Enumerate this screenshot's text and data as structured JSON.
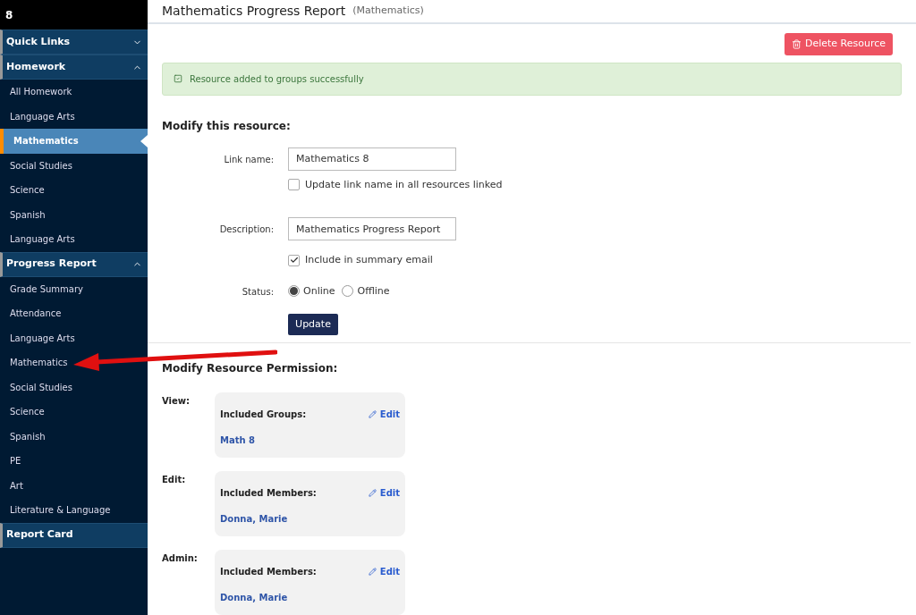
{
  "sidebar": {
    "header": "8",
    "sections": [
      {
        "title": "Quick Links",
        "expanded": false
      },
      {
        "title": "Homework",
        "expanded": true,
        "items": [
          {
            "label": "All Homework",
            "selected": false
          },
          {
            "label": "Language Arts",
            "selected": false
          },
          {
            "label": "Mathematics",
            "selected": true
          },
          {
            "label": "Social Studies",
            "selected": false
          },
          {
            "label": "Science",
            "selected": false
          },
          {
            "label": "Spanish",
            "selected": false
          },
          {
            "label": "Language Arts",
            "selected": false
          }
        ]
      },
      {
        "title": "Progress Report",
        "expanded": true,
        "items": [
          {
            "label": "Grade Summary",
            "selected": false
          },
          {
            "label": "Attendance",
            "selected": false
          },
          {
            "label": "Language Arts",
            "selected": false
          },
          {
            "label": "Mathematics",
            "selected": false
          },
          {
            "label": "Social Studies",
            "selected": false
          },
          {
            "label": "Science",
            "selected": false
          },
          {
            "label": "Spanish",
            "selected": false
          },
          {
            "label": "PE",
            "selected": false
          },
          {
            "label": "Art",
            "selected": false
          },
          {
            "label": "Literature & Language",
            "selected": false
          }
        ]
      },
      {
        "title": "Report Card"
      }
    ]
  },
  "page": {
    "title": "Mathematics Progress Report",
    "subtitle": "(Mathematics)",
    "delete_button": "Delete Resource",
    "alert": "Resource added to groups successfully"
  },
  "form": {
    "heading": "Modify this resource:",
    "link_name_label": "Link name:",
    "link_name_value": "Mathematics 8",
    "update_all": {
      "label": "Update link name in all resources linked",
      "checked": false
    },
    "description_label": "Description:",
    "description_value": "Mathematics Progress Report",
    "summary_email": {
      "label": "Include in summary email",
      "checked": true
    },
    "status_label": "Status:",
    "status_options": [
      {
        "label": "Online",
        "selected": true
      },
      {
        "label": "Offline",
        "selected": false
      }
    ],
    "submit": "Update"
  },
  "permissions": {
    "heading": "Modify Resource Permission:",
    "rows": [
      {
        "label": "View:",
        "box_title": "Included Groups:",
        "edit": "Edit",
        "value": "Math 8"
      },
      {
        "label": "Edit:",
        "box_title": "Included Members:",
        "edit": "Edit",
        "value": "Donna, Marie"
      },
      {
        "label": "Admin:",
        "box_title": "Included Members:",
        "edit": "Edit",
        "value": "Donna, Marie"
      }
    ]
  }
}
